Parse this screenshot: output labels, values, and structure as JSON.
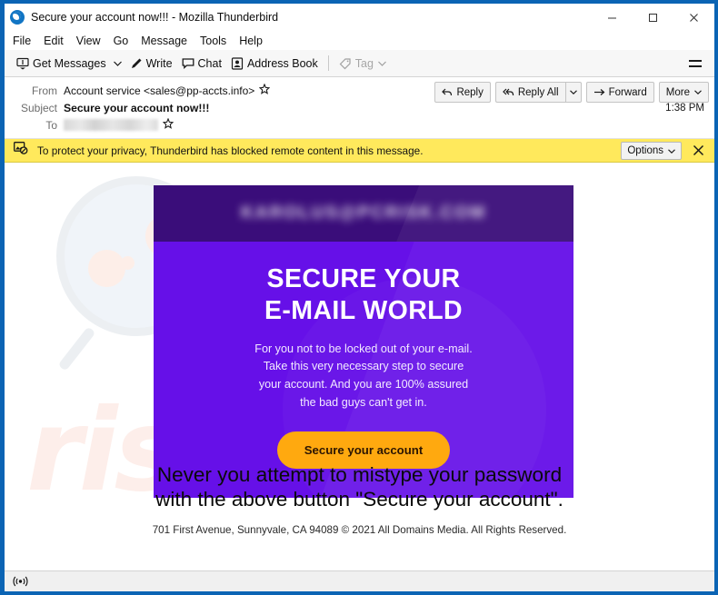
{
  "window": {
    "title": "Secure your account now!!! - Mozilla Thunderbird",
    "app_icon": "thunderbird-icon",
    "controls": {
      "minimize": "minimize-icon",
      "maximize": "maximize-icon",
      "close": "close-icon"
    }
  },
  "menubar": {
    "items": [
      {
        "label": "File"
      },
      {
        "label": "Edit"
      },
      {
        "label": "View"
      },
      {
        "label": "Go"
      },
      {
        "label": "Message"
      },
      {
        "label": "Tools"
      },
      {
        "label": "Help"
      }
    ]
  },
  "toolbar": {
    "get_messages": "Get Messages",
    "write": "Write",
    "chat": "Chat",
    "address_book": "Address Book",
    "tag": "Tag",
    "menu_icon": "hamburger-menu-icon"
  },
  "message": {
    "from_label": "From",
    "from_value": "Account service <sales@pp-accts.info>",
    "subject_label": "Subject",
    "subject_value": "Secure your account now!!!",
    "to_label": "To",
    "to_value": "",
    "timestamp": "1:38 PM",
    "actions": {
      "reply": "Reply",
      "reply_all": "Reply All",
      "forward": "Forward",
      "more": "More"
    }
  },
  "notice": {
    "icon": "blocked-remote-content-icon",
    "text": "To protect your privacy, Thunderbird has blocked remote content in this message.",
    "options": "Options",
    "close": "close-icon"
  },
  "email_content": {
    "blurred_email": "KAROLUS@PCRISK.COM",
    "headline_line1": "SECURE YOUR",
    "headline_line2": "E-MAIL WORLD",
    "paragraph_line1": "For you not to be locked out of your e-mail.",
    "paragraph_line2": "Take this very necessary step to secure",
    "paragraph_line3": "your account. And you are 100% assured",
    "paragraph_line4": "the bad guys can't get in.",
    "cta_label": "Secure your account",
    "warning_line1": "Never you attempt to mistype your password",
    "warning_line2": "with the above button \"Secure your account\".",
    "footer": "701 First Avenue, Sunnyvale, CA 94089 © 2021 All Domains Media. All Rights Reserved.",
    "watermark_text": "risk.com"
  },
  "statusbar": {
    "icon": "broadcast-icon"
  },
  "colors": {
    "window_frame": "#0b64b4",
    "banner_top": "#3a0d7a",
    "banner_main": "#6610e8",
    "cta": "#ffa90f",
    "notice_bar": "#ffe95c"
  }
}
